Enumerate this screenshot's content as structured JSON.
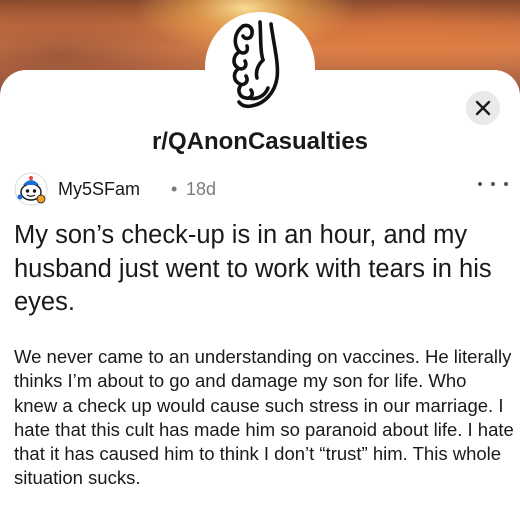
{
  "community": {
    "name": "r/QAnonCasualties",
    "icon": "hands-clasped-icon"
  },
  "post": {
    "author": "My5SFam",
    "separator": "•",
    "age": "18d",
    "title": "My son’s check-up is in an hour, and my husband just went to work with tears in his eyes.",
    "body": "We never came to an understanding on vaccines. He literally thinks I’m about to go and damage my son for life. Who knew a check up would cause such stress in our marriage. I hate that this cult has made him so paranoid about life. I hate that it has caused him to think I don’t “trust” him. This whole situation sucks."
  },
  "icons": {
    "close": "close-icon",
    "more": "more-options-icon",
    "avatar": "snoo-avatar-icon"
  },
  "colors": {
    "text": "#1a1a1b",
    "muted": "#787c7e",
    "close_bg": "#e9e9ec",
    "banner_glow": "#d9824a"
  }
}
